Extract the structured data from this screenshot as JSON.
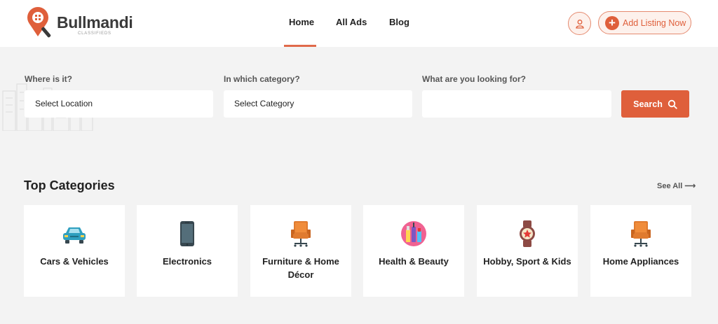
{
  "header": {
    "logo_text": "Bullmandi",
    "logo_sub": "CLASSIFIEDS",
    "nav": [
      "Home",
      "All Ads",
      "Blog"
    ],
    "active_nav": "Home",
    "add_listing_label": "Add Listing Now",
    "accent_color": "#df5f3b"
  },
  "search": {
    "location_label": "Where is it?",
    "location_value": "Select Location",
    "category_label": "In which category?",
    "category_value": "Select Category",
    "keyword_label": "What are you looking for?",
    "keyword_value": "",
    "button_label": "Search"
  },
  "categories": {
    "title": "Top Categories",
    "see_all": "See All",
    "items": [
      {
        "label": "Cars & Vehicles",
        "icon": "car-icon"
      },
      {
        "label": "Electronics",
        "icon": "smartphone-icon"
      },
      {
        "label": "Furniture & Home Décor",
        "icon": "armchair-icon"
      },
      {
        "label": "Health & Beauty",
        "icon": "cosmetics-icon"
      },
      {
        "label": "Hobby, Sport & Kids",
        "icon": "watch-icon"
      },
      {
        "label": "Home Appliances",
        "icon": "armchair-icon"
      }
    ]
  }
}
